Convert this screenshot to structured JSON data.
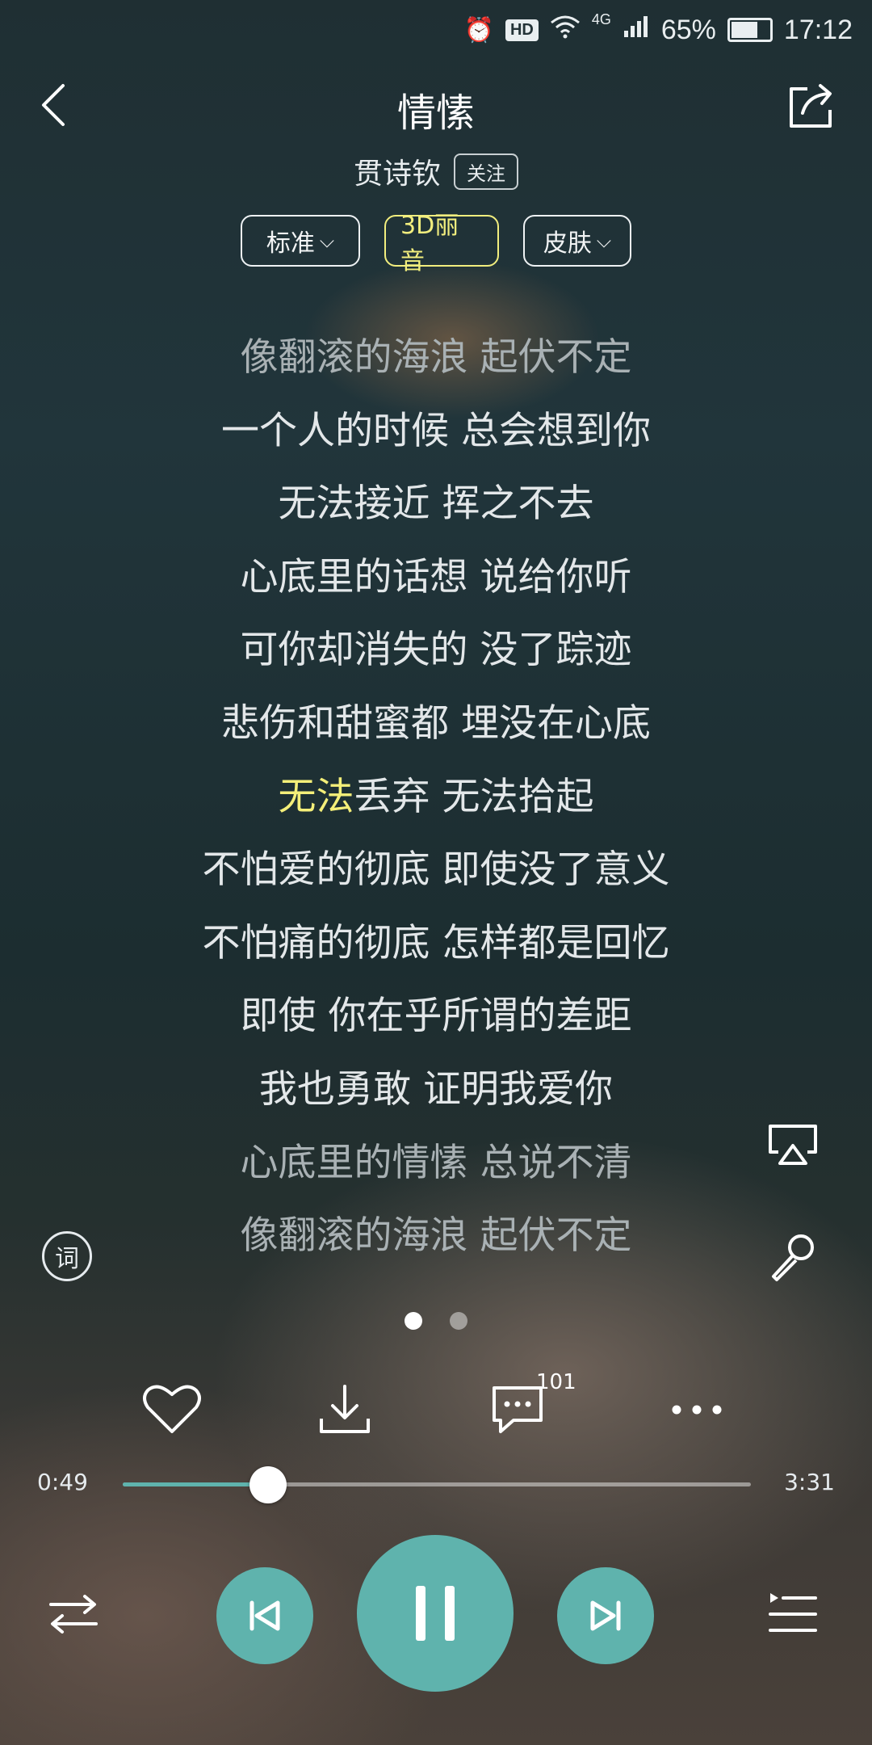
{
  "status_bar": {
    "alarm_icon": "alarm-clock-icon",
    "hd_badge": "HD",
    "wifi_icon": "wifi-icon",
    "network": "4G",
    "signal_icon": "signal-icon",
    "battery": "65%",
    "battery_level": 0.65,
    "time": "17:12"
  },
  "header": {
    "title": "情愫",
    "artist": "贯诗钦",
    "follow_label": "关注"
  },
  "pills": {
    "quality_label": "标准",
    "sound_effect_label": "3D丽音",
    "skin_label": "皮肤"
  },
  "lyrics": {
    "lines": [
      "像翻滚的海浪 起伏不定",
      "一个人的时候 总会想到你",
      "无法接近 挥之不去",
      "心底里的话想 说给你听",
      "可你却消失的 没了踪迹",
      "悲伤和甜蜜都 埋没在心底",
      "无法丢弃 无法拾起",
      "不怕爱的彻底 即使没了意义",
      "不怕痛的彻底 怎样都是回忆",
      "即使 你在乎所谓的差距",
      "我也勇敢 证明我爱你",
      "心底里的情愫 总说不清",
      "像翻滚的海浪 起伏不定"
    ],
    "current_highlight": "无法",
    "current_rest": "丢弃 无法拾起",
    "lyrics_mode_label": "词"
  },
  "actions": {
    "comment_count": "101"
  },
  "progress": {
    "current": "0:49",
    "total": "3:31",
    "fraction": 0.232
  },
  "colors": {
    "accent": "#5fb3ad",
    "highlight": "#f4ef79"
  }
}
